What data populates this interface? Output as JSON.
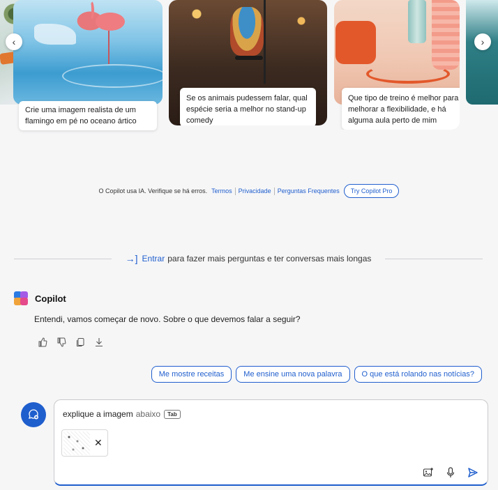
{
  "carousel": {
    "cards": [
      {
        "caption": "Crie uma imagem realista de um flamingo em pé no oceano ártico"
      },
      {
        "caption": "Se os animais pudessem falar, qual espécie seria a melhor no stand-up comedy"
      },
      {
        "caption": "Que tipo de treino é melhor para melhorar a flexibilidade, e há alguma aula perto de mim"
      }
    ],
    "prev_icon": "‹",
    "next_icon": "›"
  },
  "disclaimer": {
    "text": "O Copilot usa IA. Verifique se há erros.",
    "links": [
      "Termos",
      "Privacidade",
      "Perguntas Frequentes"
    ],
    "try_pro": "Try Copilot Pro"
  },
  "signin": {
    "icon": "→]",
    "link": "Entrar",
    "text": "para fazer mais perguntas e ter conversas mais longas"
  },
  "bot": {
    "name": "Copilot",
    "message": "Entendi, vamos começar de novo. Sobre o que devemos falar a seguir?",
    "logo_colors": [
      "#2b7be4",
      "#a35ce6",
      "#f0a33a",
      "#e54a8b"
    ]
  },
  "suggestions": [
    "Me mostre receitas",
    "Me ensine uma nova palavra",
    "O que está rolando nas notícias?"
  ],
  "input": {
    "query": "explique a imagem",
    "suggestion": "abaixo",
    "tab_key": "Tab",
    "remove_icon": "✕"
  },
  "colors": {
    "accent": "#1f5ecd",
    "background": "#f6f6f7"
  }
}
